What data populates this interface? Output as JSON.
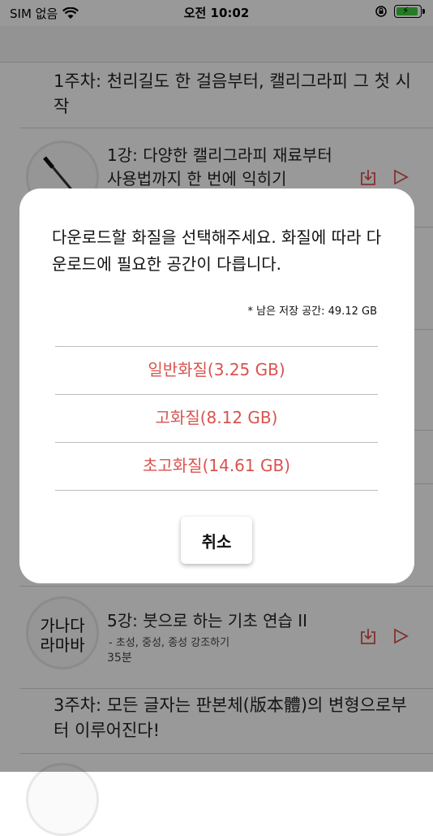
{
  "status_bar": {
    "carrier": "SIM 없음",
    "time": "오전 10:02"
  },
  "list": {
    "section_1": "1주차: 천리길도 한 걸음부터, 캘리그라피 그 첫 시작",
    "lesson_1_title": "1강: 다양한 캘리그라피 재료부터 사용법까지 한 번에 익히기",
    "lesson_5_title": "5강: 붓으로 하는 기초 연습 II",
    "lesson_5_sub": "- 초성, 중성, 종성 강조하기",
    "lesson_5_duration": "35분",
    "lesson_5_thumb_text": "가나다라마바",
    "section_3": "3주차: 모든 글자는 판본체(版本體)의 변형으로부터 이루어진다!"
  },
  "dialog": {
    "message": "다운로드할 화질을 선택해주세요. 화질에 따라 다운로드에 필요한 공간이 다릅니다.",
    "storage_note": "* 남은 저장 공간: 49.12 GB",
    "options": [
      "일반화질(3.25 GB)",
      "고화질(8.12 GB)",
      "초고화질(14.61 GB)"
    ],
    "cancel_label": "취소"
  },
  "colors": {
    "accent": "#d9534f",
    "overlay": "rgba(0,0,0,0.4)"
  }
}
